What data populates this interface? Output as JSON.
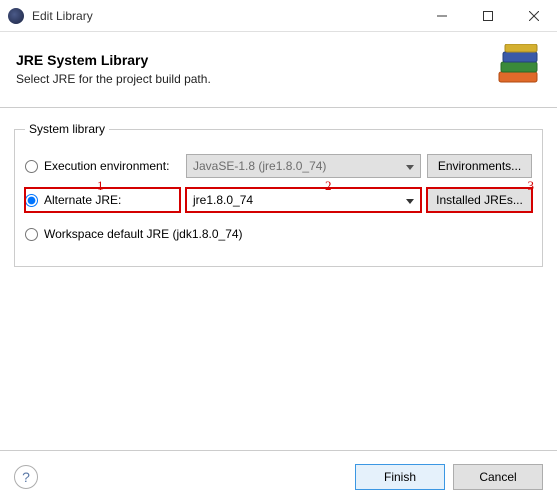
{
  "titlebar": {
    "title": "Edit Library"
  },
  "header": {
    "title": "JRE System Library",
    "subtitle": "Select JRE for the project build path."
  },
  "group": {
    "legend": "System library",
    "rows": {
      "exec_env": {
        "label": "Execution environment:",
        "value": "JavaSE-1.8 (jre1.8.0_74)",
        "button": "Environments...",
        "checked": false
      },
      "alt_jre": {
        "label": "Alternate JRE:",
        "value": "jre1.8.0_74",
        "button": "Installed JREs...",
        "checked": true
      },
      "workspace": {
        "label": "Workspace default JRE (jdk1.8.0_74)",
        "checked": false
      }
    }
  },
  "annotations": {
    "a1": "1",
    "a2": "2",
    "a3": "3"
  },
  "footer": {
    "finish": "Finish",
    "cancel": "Cancel"
  }
}
